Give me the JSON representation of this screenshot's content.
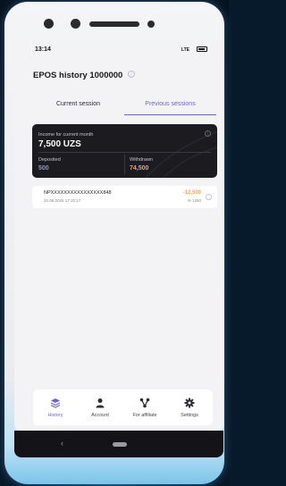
{
  "status_bar": {
    "time": "13:14",
    "signal": "LTE"
  },
  "header": {
    "title": "EPOS history 1000000"
  },
  "tabs": [
    {
      "label": "Current session",
      "active": false
    },
    {
      "label": "Previous sessions",
      "active": true
    }
  ],
  "summary": {
    "income_label": "Income for current month",
    "income_value": "7,500 UZS",
    "deposited_label": "Deposited",
    "deposited_value": "500",
    "withdrawn_label": "Withdrawn",
    "withdrawn_value": "74,500"
  },
  "transactions": [
    {
      "id": "NPXXXXXXXXXXXXXXXX848",
      "datetime": "20.08.2025 17:32:17",
      "amount": "-12,500",
      "fee": "% 1250"
    }
  ],
  "bottom_nav": [
    {
      "label": "History",
      "icon": "layers-icon",
      "active": true
    },
    {
      "label": "Account",
      "icon": "user-icon",
      "active": false
    },
    {
      "label": "For affiliate",
      "icon": "network-icon",
      "active": false
    },
    {
      "label": "Settings",
      "icon": "gear-icon",
      "active": false
    }
  ],
  "colors": {
    "accent": "#6d64c9",
    "card_bg": "#1b1b20",
    "deposited": "#8f8bff",
    "withdrawn": "#f0a35c"
  }
}
